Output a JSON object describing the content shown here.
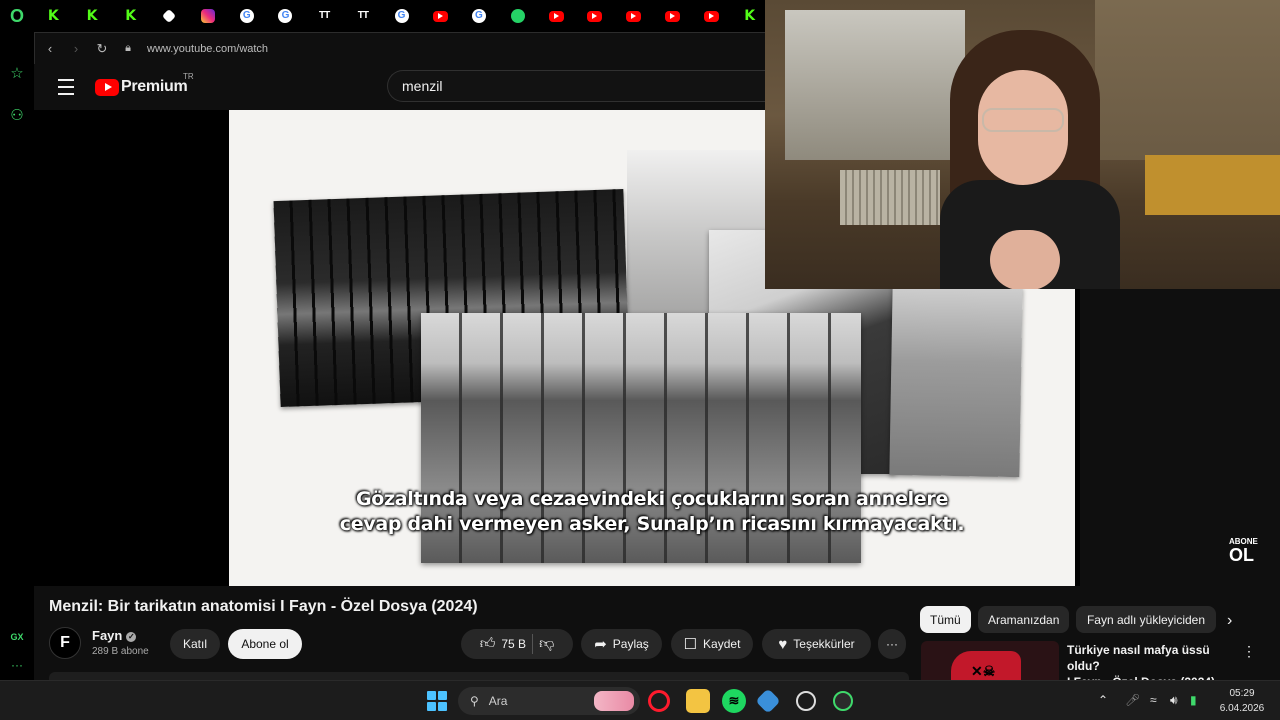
{
  "browser": {
    "pinned_tabs": [
      {
        "icon": "kick-icon",
        "glyph": "K",
        "kind": "k"
      },
      {
        "icon": "kick-icon",
        "glyph": "K",
        "kind": "k"
      },
      {
        "icon": "kick-icon",
        "glyph": "K",
        "kind": "k"
      },
      {
        "icon": "github-icon",
        "glyph": "",
        "kind": "gh"
      },
      {
        "icon": "instagram-icon",
        "glyph": "",
        "kind": "ig"
      },
      {
        "icon": "google-icon",
        "glyph": "G",
        "kind": "g"
      },
      {
        "icon": "google-icon",
        "glyph": "G",
        "kind": "g"
      },
      {
        "icon": "twitch-tracker-icon",
        "glyph": "TT",
        "kind": "tv"
      },
      {
        "icon": "twitch-tracker-icon",
        "glyph": "TT",
        "kind": "tv"
      },
      {
        "icon": "google-icon",
        "glyph": "G",
        "kind": "g"
      },
      {
        "icon": "youtube-icon",
        "glyph": "",
        "kind": "yt"
      },
      {
        "icon": "google-icon",
        "glyph": "G",
        "kind": "g"
      },
      {
        "icon": "whatsapp-icon",
        "glyph": "",
        "kind": "wa"
      },
      {
        "icon": "youtube-icon",
        "glyph": "",
        "kind": "yt"
      },
      {
        "icon": "youtube-icon",
        "glyph": "",
        "kind": "yt"
      },
      {
        "icon": "youtube-icon",
        "glyph": "",
        "kind": "yt"
      },
      {
        "icon": "youtube-icon",
        "glyph": "",
        "kind": "yt"
      },
      {
        "icon": "youtube-icon",
        "glyph": "",
        "kind": "yt"
      },
      {
        "icon": "kick-icon",
        "glyph": "K",
        "kind": "k"
      }
    ],
    "url": "www.youtube.com/watch",
    "sidebar_gx": "GX",
    "sidebar_more": "···"
  },
  "youtube": {
    "logo_text": "Premium",
    "country_code": "TR",
    "search_value": "menzil",
    "video": {
      "subtitle_line1": "Gözaltında veya cezaevindeki çocuklarını soran annelere",
      "subtitle_line2": "cevap dahi vermeyen asker, Sunalp’ın ricasını kırmayacaktı.",
      "watermark_top": "ABONE",
      "watermark_bottom": "OL"
    },
    "title": "Menzil: Bir tarikatın anatomisi I Fayn - Özel Dosya (2024)",
    "channel": {
      "avatar_letter": "F",
      "name": "Fayn",
      "subscribers": "289 B abone",
      "join_label": "Katıl",
      "subscribe_label": "Abone ol"
    },
    "actions": {
      "likes": "75 B",
      "share": "Paylaş",
      "save": "Kaydet",
      "thanks": "Teşekkürler"
    },
    "chips": [
      "Tümü",
      "Aramanızdan",
      "Fayn adlı yükleyiciden"
    ],
    "recommendation": {
      "title_line1": "Türkiye nasıl mafya üssü oldu?",
      "title_line2": "I Fayn - Özel Dosya (2024)"
    }
  },
  "taskbar": {
    "search_placeholder": "Ara",
    "time": "05:29",
    "date": "6.04.2026",
    "accent_color": "#4cc2ff"
  }
}
